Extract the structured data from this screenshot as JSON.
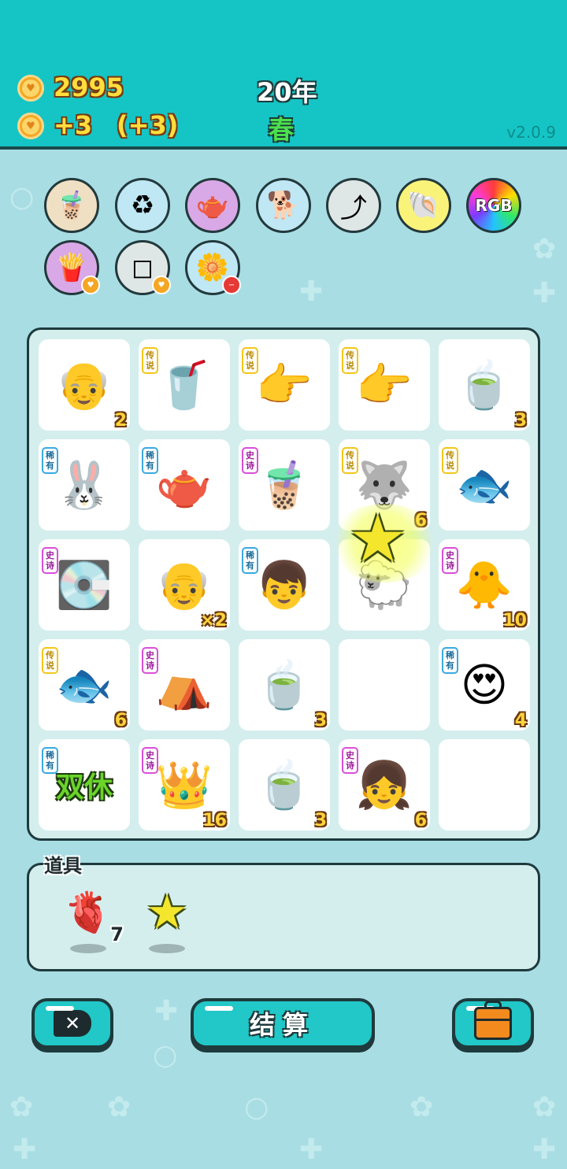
{
  "header": {
    "coins": "2995",
    "income": "+3",
    "income_bonus": "(+3)",
    "year": "20年",
    "season": "春",
    "version": "v2.0.9"
  },
  "buffs": [
    {
      "icon": "bubble-tea-dome-icon",
      "glyph": "🧋",
      "bg": "#efe0c4"
    },
    {
      "icon": "recycle-bag-icon",
      "glyph": "♻",
      "bg": "#bfe7f4"
    },
    {
      "icon": "gravy-boat-icon",
      "glyph": "🫖",
      "bg": "#d9a8e6"
    },
    {
      "icon": "doge-sunglasses-icon",
      "glyph": "🐕",
      "bg": "#bfe7f4"
    },
    {
      "icon": "arrow-card-icon",
      "glyph": "⤴",
      "bg": "#dfe6e6"
    },
    {
      "icon": "seashell-icon",
      "glyph": "🐚",
      "bg": "#faf37a"
    },
    {
      "icon": "rgb-icon",
      "glyph": "RGB",
      "bg": "rainbow"
    },
    {
      "icon": "fries-icon",
      "glyph": "🍟",
      "bg": "#d9a8e6"
    },
    {
      "icon": "sugar-cubes-icon",
      "glyph": "◻",
      "bg": "#dfe6e6"
    },
    {
      "icon": "potted-flower-icon",
      "glyph": "🌼",
      "bg": "#bfe7f4"
    }
  ],
  "rarity_labels": {
    "legend": "传说",
    "rare": "稀有",
    "epic": "史诗"
  },
  "board": [
    {
      "icon": "bald-grandpa-glasses-icon",
      "glyph": "👴",
      "rarity": "",
      "count": "2"
    },
    {
      "icon": "bubble-tea-cup-icon",
      "glyph": "🥤",
      "rarity": "legend",
      "count": ""
    },
    {
      "icon": "pointing-finger-icon",
      "glyph": "👉",
      "rarity": "legend",
      "count": ""
    },
    {
      "icon": "pointing-finger-icon",
      "glyph": "👉",
      "rarity": "legend",
      "count": ""
    },
    {
      "icon": "tea-bowl-icon",
      "glyph": "🍵",
      "rarity": "",
      "count": "3"
    },
    {
      "icon": "rabbit-icon",
      "glyph": "🐰",
      "rarity": "rare",
      "count": ""
    },
    {
      "icon": "teapot-icon",
      "glyph": "🫖",
      "rarity": "rare",
      "count": ""
    },
    {
      "icon": "boba-cup-icon",
      "glyph": "🧋",
      "rarity": "epic",
      "count": ""
    },
    {
      "icon": "husky-king-icon",
      "glyph": "🐺",
      "rarity": "legend",
      "count": "6"
    },
    {
      "icon": "koi-fish-icon",
      "glyph": "🐟",
      "rarity": "legend",
      "count": ""
    },
    {
      "icon": "graphics-card-icon",
      "glyph": "💽",
      "rarity": "epic",
      "count": ""
    },
    {
      "icon": "bald-grandpa-glasses-icon",
      "glyph": "👴",
      "rarity": "",
      "count": "×2"
    },
    {
      "icon": "boy-glasses-icon",
      "glyph": "👦",
      "rarity": "rare",
      "count": ""
    },
    {
      "icon": "sheep-icon",
      "glyph": "🐑",
      "rarity": "",
      "count": ""
    },
    {
      "icon": "yellow-chick-face-icon",
      "glyph": "🐥",
      "rarity": "epic",
      "count": "10"
    },
    {
      "icon": "koi-fish-icon",
      "glyph": "🐟",
      "rarity": "legend",
      "count": "6"
    },
    {
      "icon": "rabbit-tent-icon",
      "glyph": "⛺",
      "rarity": "epic",
      "count": ""
    },
    {
      "icon": "tea-bowl-icon",
      "glyph": "🍵",
      "rarity": "",
      "count": "3"
    },
    {
      "icon": "empty-cell",
      "glyph": "",
      "rarity": "",
      "count": ""
    },
    {
      "icon": "heart-eyes-bald-man-icon",
      "glyph": "😍",
      "rarity": "rare",
      "count": "4"
    },
    {
      "icon": "double-rest-icon",
      "glyph": "双休",
      "rarity": "rare",
      "count": ""
    },
    {
      "icon": "crowned-grandpa-6g-icon",
      "glyph": "👑",
      "rarity": "epic",
      "count": "16"
    },
    {
      "icon": "tea-bowl-icon",
      "glyph": "🍵",
      "rarity": "",
      "count": "3"
    },
    {
      "icon": "heart-eyes-girl-icon",
      "glyph": "👧",
      "rarity": "epic",
      "count": "6"
    },
    {
      "icon": "empty-cell",
      "glyph": "",
      "rarity": "",
      "count": ""
    }
  ],
  "items": {
    "label": "道具",
    "list": [
      {
        "icon": "liver-icon",
        "glyph": "🫀",
        "count": "7"
      },
      {
        "icon": "star-icon",
        "glyph": "★",
        "count": ""
      }
    ]
  },
  "buttons": {
    "settle_label": "结算"
  },
  "colors": {
    "header": "#15c5c5",
    "background": "#a9dde4",
    "button": "#22c7c7"
  }
}
